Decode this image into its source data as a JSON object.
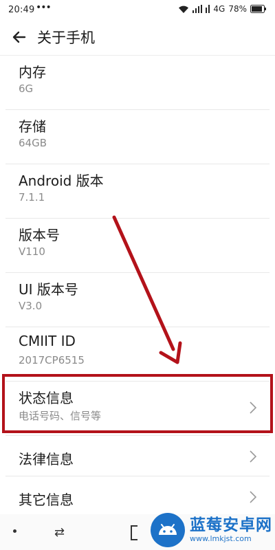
{
  "status_bar": {
    "time": "20:49",
    "dots": "•••",
    "network": "4G",
    "battery": "78%"
  },
  "header": {
    "title": "关于手机"
  },
  "items": [
    {
      "label": "内存",
      "value": "6G"
    },
    {
      "label": "存储",
      "value": "64GB"
    },
    {
      "label": "Android 版本",
      "value": "7.1.1"
    },
    {
      "label": "版本号",
      "value": "V110"
    },
    {
      "label": "UI 版本号",
      "value": "V3.0"
    },
    {
      "label": "CMIIT ID",
      "value": "2017CP6515"
    },
    {
      "label": "状态信息",
      "value": "电话号码、信号等"
    },
    {
      "label": "法律信息"
    },
    {
      "label": "其它信息"
    }
  ],
  "nav_bar": {
    "switch_glyph": "⇄"
  },
  "watermark": {
    "name": "蓝莓安卓网",
    "url": "www.lmkjst.com"
  },
  "colors": {
    "highlight": "#b3121a",
    "watermark": "#1d72c8"
  }
}
